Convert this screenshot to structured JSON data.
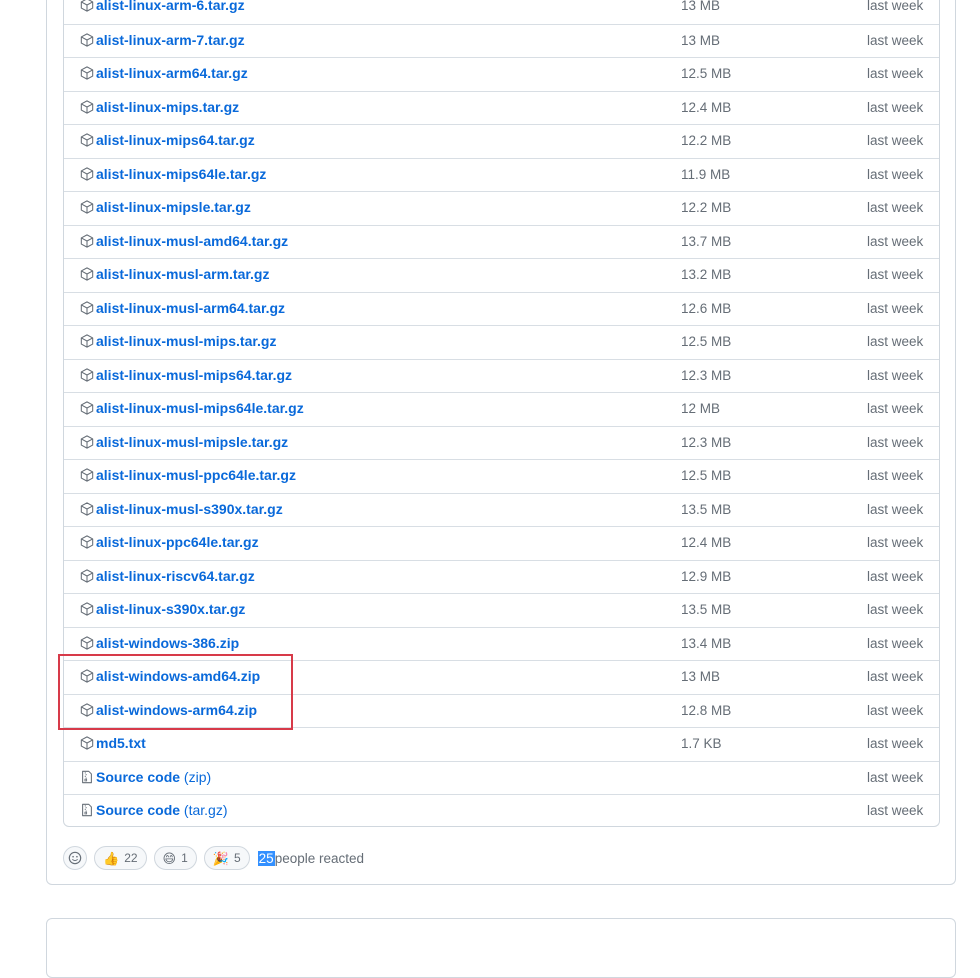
{
  "assets": [
    {
      "name": "alist-linux-arm-6.tar.gz",
      "size": "13 MB",
      "date": "last week",
      "icon": "package-icon"
    },
    {
      "name": "alist-linux-arm-7.tar.gz",
      "size": "13 MB",
      "date": "last week",
      "icon": "package-icon"
    },
    {
      "name": "alist-linux-arm64.tar.gz",
      "size": "12.5 MB",
      "date": "last week",
      "icon": "package-icon"
    },
    {
      "name": "alist-linux-mips.tar.gz",
      "size": "12.4 MB",
      "date": "last week",
      "icon": "package-icon"
    },
    {
      "name": "alist-linux-mips64.tar.gz",
      "size": "12.2 MB",
      "date": "last week",
      "icon": "package-icon"
    },
    {
      "name": "alist-linux-mips64le.tar.gz",
      "size": "11.9 MB",
      "date": "last week",
      "icon": "package-icon"
    },
    {
      "name": "alist-linux-mipsle.tar.gz",
      "size": "12.2 MB",
      "date": "last week",
      "icon": "package-icon"
    },
    {
      "name": "alist-linux-musl-amd64.tar.gz",
      "size": "13.7 MB",
      "date": "last week",
      "icon": "package-icon"
    },
    {
      "name": "alist-linux-musl-arm.tar.gz",
      "size": "13.2 MB",
      "date": "last week",
      "icon": "package-icon"
    },
    {
      "name": "alist-linux-musl-arm64.tar.gz",
      "size": "12.6 MB",
      "date": "last week",
      "icon": "package-icon"
    },
    {
      "name": "alist-linux-musl-mips.tar.gz",
      "size": "12.5 MB",
      "date": "last week",
      "icon": "package-icon"
    },
    {
      "name": "alist-linux-musl-mips64.tar.gz",
      "size": "12.3 MB",
      "date": "last week",
      "icon": "package-icon"
    },
    {
      "name": "alist-linux-musl-mips64le.tar.gz",
      "size": "12 MB",
      "date": "last week",
      "icon": "package-icon"
    },
    {
      "name": "alist-linux-musl-mipsle.tar.gz",
      "size": "12.3 MB",
      "date": "last week",
      "icon": "package-icon"
    },
    {
      "name": "alist-linux-musl-ppc64le.tar.gz",
      "size": "12.5 MB",
      "date": "last week",
      "icon": "package-icon"
    },
    {
      "name": "alist-linux-musl-s390x.tar.gz",
      "size": "13.5 MB",
      "date": "last week",
      "icon": "package-icon"
    },
    {
      "name": "alist-linux-ppc64le.tar.gz",
      "size": "12.4 MB",
      "date": "last week",
      "icon": "package-icon"
    },
    {
      "name": "alist-linux-riscv64.tar.gz",
      "size": "12.9 MB",
      "date": "last week",
      "icon": "package-icon"
    },
    {
      "name": "alist-linux-s390x.tar.gz",
      "size": "13.5 MB",
      "date": "last week",
      "icon": "package-icon"
    },
    {
      "name": "alist-windows-386.zip",
      "size": "13.4 MB",
      "date": "last week",
      "icon": "package-icon"
    },
    {
      "name": "alist-windows-amd64.zip",
      "size": "13 MB",
      "date": "last week",
      "icon": "package-icon"
    },
    {
      "name": "alist-windows-arm64.zip",
      "size": "12.8 MB",
      "date": "last week",
      "icon": "package-icon"
    },
    {
      "name": "md5.txt",
      "size": "1.7 KB",
      "date": "last week",
      "icon": "package-icon"
    },
    {
      "name": "Source code",
      "suffix": "(zip)",
      "size": "",
      "date": "last week",
      "icon": "file-zip-icon"
    },
    {
      "name": "Source code",
      "suffix": "(tar.gz)",
      "size": "",
      "date": "last week",
      "icon": "file-zip-icon"
    }
  ],
  "reactions": {
    "items": [
      {
        "emoji": "👍",
        "count": "22",
        "icon": "thumbs-up-icon"
      },
      {
        "emoji": "😄",
        "count": "1",
        "icon": "laugh-icon"
      },
      {
        "emoji": "🎉",
        "count": "5",
        "icon": "hooray-icon"
      }
    ],
    "total": "25",
    "summary": "people reacted"
  },
  "colors": {
    "link": "#0969da",
    "muted": "#656d76",
    "border": "#d0d7de",
    "highlight": "#d73a49",
    "selection": "#3390ff"
  }
}
